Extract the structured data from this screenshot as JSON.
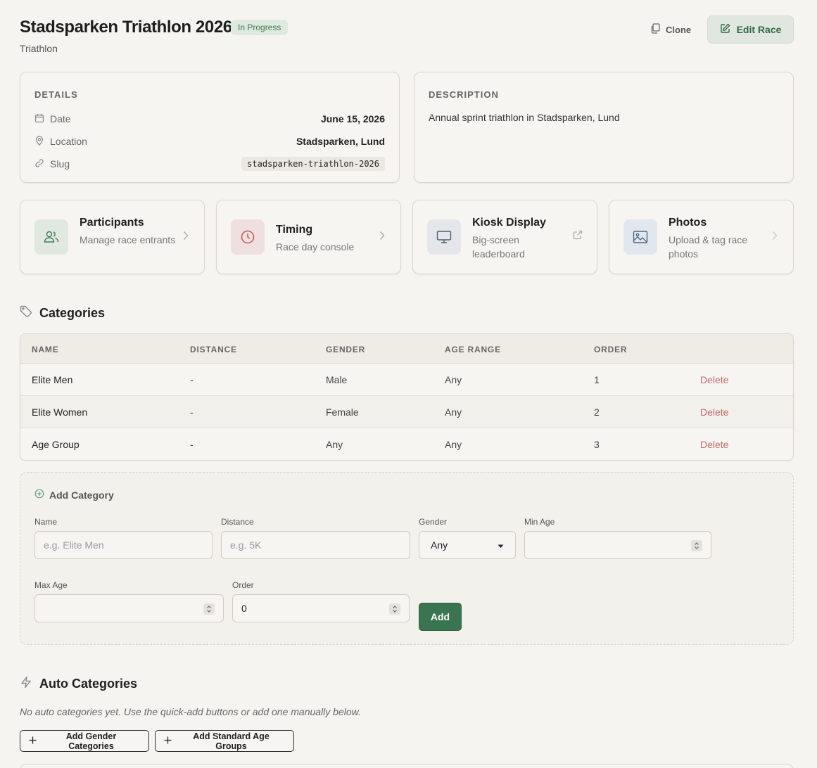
{
  "header": {
    "title": "Stadsparken Triathlon 2026",
    "status": "In Progress",
    "subtitle": "Triathlon",
    "clone_label": "Clone",
    "edit_label": "Edit Race"
  },
  "details": {
    "heading": "DETAILS",
    "date_label": "Date",
    "date_value": "June 15, 2026",
    "location_label": "Location",
    "location_value": "Stadsparken, Lund",
    "slug_label": "Slug",
    "slug_value": "stadsparken-triathlon-2026"
  },
  "description": {
    "heading": "DESCRIPTION",
    "text": "Annual sprint triathlon in Stadsparken, Lund"
  },
  "quick_links": [
    {
      "title": "Participants",
      "subtitle": "Manage race entrants",
      "icon": "users-icon"
    },
    {
      "title": "Timing",
      "subtitle": "Race day console",
      "icon": "clock-icon"
    },
    {
      "title": "Kiosk Display",
      "subtitle": "Big-screen leaderboard",
      "icon": "monitor-icon"
    },
    {
      "title": "Photos",
      "subtitle": "Upload & tag race photos",
      "icon": "image-icon"
    }
  ],
  "categories": {
    "heading": "Categories",
    "columns": [
      "NAME",
      "DISTANCE",
      "GENDER",
      "AGE RANGE",
      "ORDER"
    ],
    "rows": [
      {
        "name": "Elite Men",
        "distance": "-",
        "gender": "Male",
        "age_range": "Any",
        "order": "1",
        "action": "Delete"
      },
      {
        "name": "Elite Women",
        "distance": "-",
        "gender": "Female",
        "age_range": "Any",
        "order": "2",
        "action": "Delete"
      },
      {
        "name": "Age Group",
        "distance": "-",
        "gender": "Any",
        "age_range": "Any",
        "order": "3",
        "action": "Delete"
      }
    ]
  },
  "add_category": {
    "heading": "Add Category",
    "name_label": "Name",
    "name_placeholder": "e.g. Elite Men",
    "distance_label": "Distance",
    "distance_placeholder": "e.g. 5K",
    "gender_label": "Gender",
    "gender_value": "Any",
    "min_age_label": "Min Age",
    "max_age_label": "Max Age",
    "order_label": "Order",
    "order_value": "0",
    "add_label": "Add"
  },
  "auto_categories": {
    "heading": "Auto Categories",
    "note": "No auto categories yet. Use the quick-add buttons or add one manually below.",
    "gender_button": "Add Gender Categories",
    "age_button": "Add Standard Age Groups"
  },
  "colors": {
    "accent": "#3a7450",
    "danger": "#c46a6a",
    "background": "#f6f4f0"
  }
}
